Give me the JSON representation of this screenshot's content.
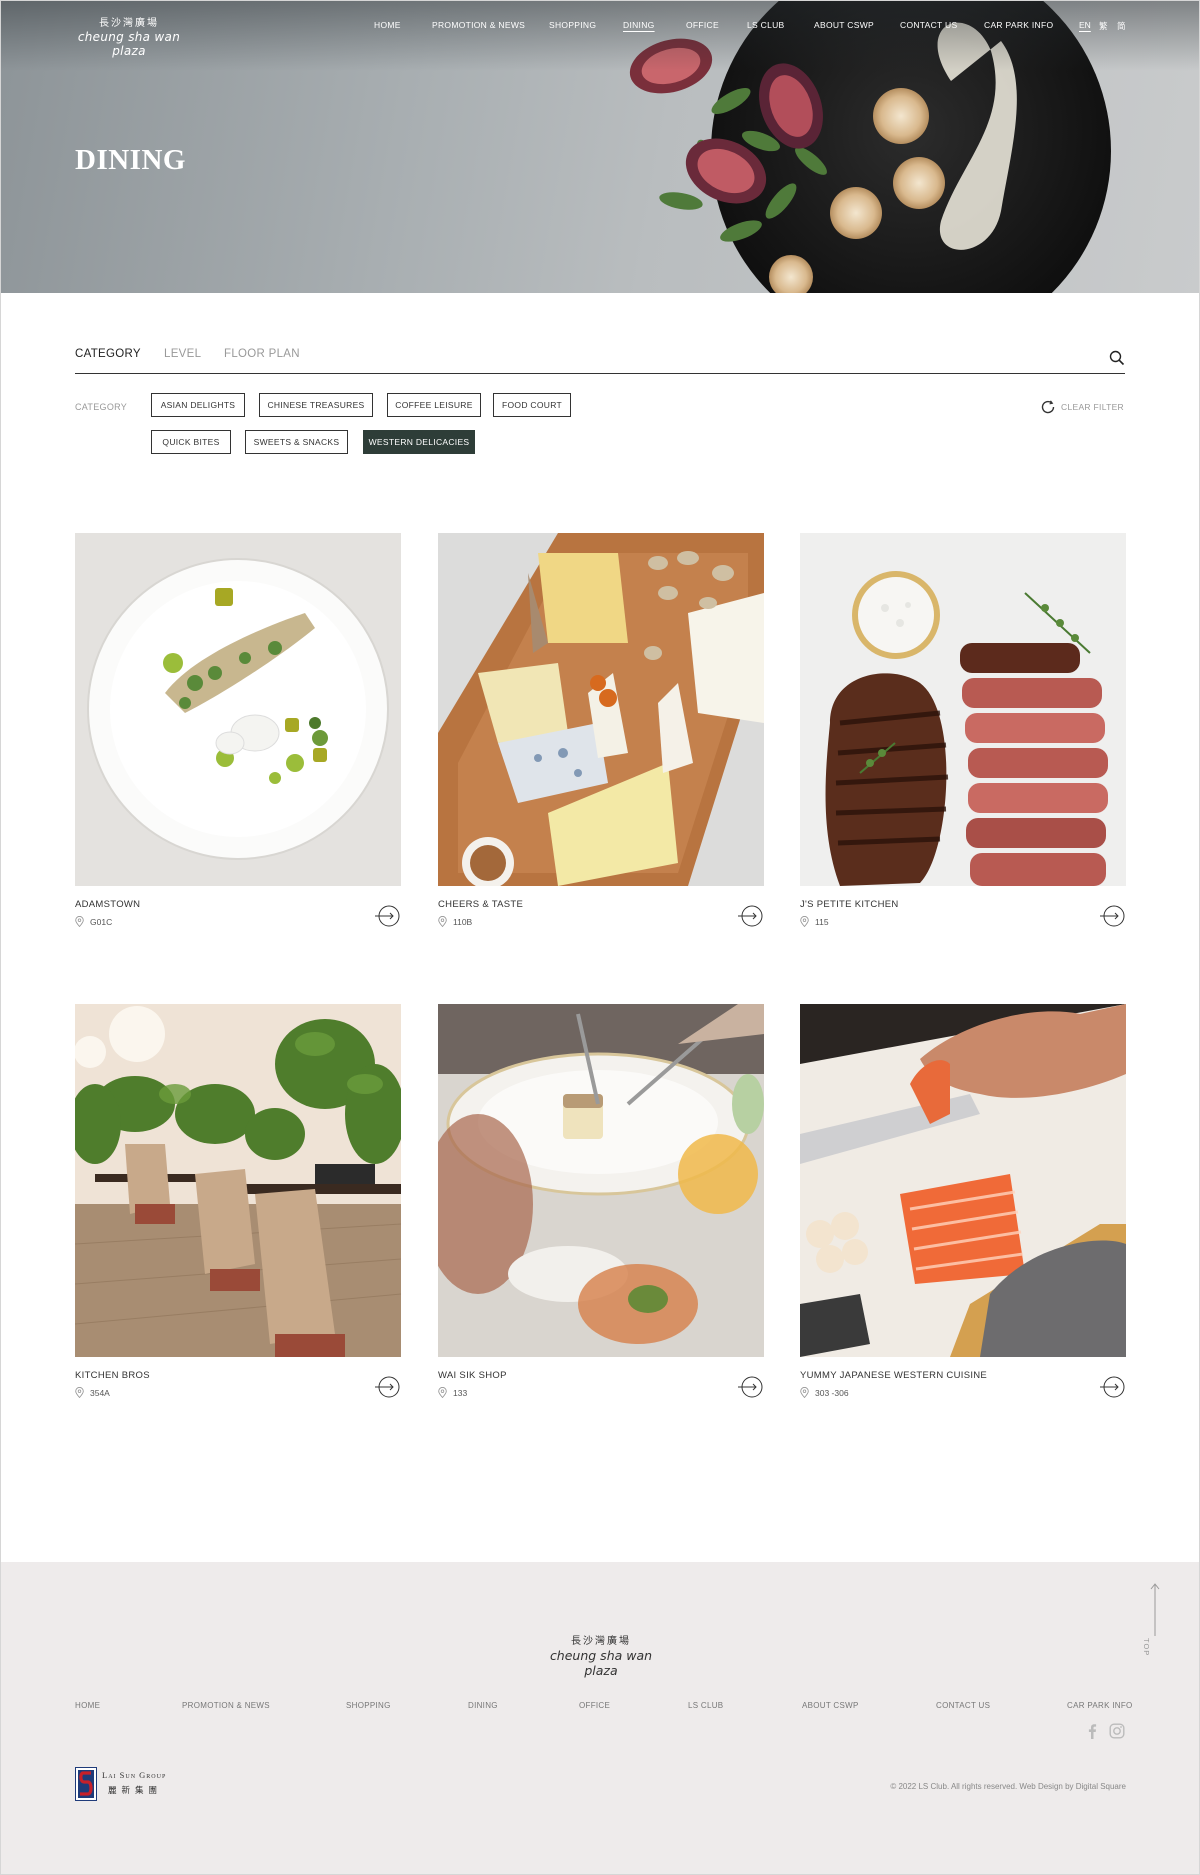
{
  "header": {
    "logo_zh": "長沙灣廣場",
    "logo_en": "cheung sha wan plaza",
    "nav": [
      "HOME",
      "PROMOTION & NEWS",
      "SHOPPING",
      "DINING",
      "OFFICE",
      "LS CLUB",
      "ABOUT CSWP",
      "CONTACT US",
      "CAR PARK INFO"
    ],
    "active_nav": "DINING",
    "languages": [
      "EN",
      "繁",
      "简"
    ],
    "active_language": "EN"
  },
  "hero": {
    "title": "DINING"
  },
  "filter": {
    "tabs": [
      "CATEGORY",
      "LEVEL",
      "FLOOR PLAN"
    ],
    "active_tab": "CATEGORY",
    "category_label": "CATEGORY",
    "chips": [
      "ASIAN DELIGHTS",
      "CHINESE TREASURES",
      "COFFEE LEISURE",
      "FOOD COURT",
      "QUICK BITES",
      "SWEETS & SNACKS",
      "WESTERN DELICACIES"
    ],
    "active_chip": "WESTERN DELICACIES",
    "clear_label": "CLEAR FILTER",
    "icons": {
      "search": "search-icon",
      "clear": "refresh-icon"
    }
  },
  "shops": [
    {
      "name": "ADAMSTOWN",
      "location": "G01C"
    },
    {
      "name": "CHEERS & TASTE",
      "location": "110B"
    },
    {
      "name": "J'S PETITE KITCHEN",
      "location": "115"
    },
    {
      "name": "KITCHEN BROS",
      "location": "354A"
    },
    {
      "name": "WAI SIK SHOP",
      "location": "133"
    },
    {
      "name": "YUMMY JAPANESE WESTERN CUISINE",
      "location": "303 -306"
    }
  ],
  "footer": {
    "logo_zh": "長沙灣廣場",
    "logo_en": "cheung sha wan plaza",
    "nav": [
      "HOME",
      "PROMOTION & NEWS",
      "SHOPPING",
      "DINING",
      "OFFICE",
      "LS CLUB",
      "ABOUT CSWP",
      "CONTACT US",
      "CAR PARK INFO"
    ],
    "top_label": "TOP",
    "group_logo_en": "Lai Sun Group",
    "group_logo_zh": "麗新集團",
    "copyright": "© 2022 LS Club. All rights reserved.   Web Design by Digital Square",
    "social": [
      "facebook-icon",
      "instagram-icon"
    ]
  },
  "colors": {
    "active_chip": "#2e3d38",
    "footer_bg": "#eeebeb",
    "accent_red": "#c8202a",
    "accent_blue": "#1f3b7a"
  }
}
